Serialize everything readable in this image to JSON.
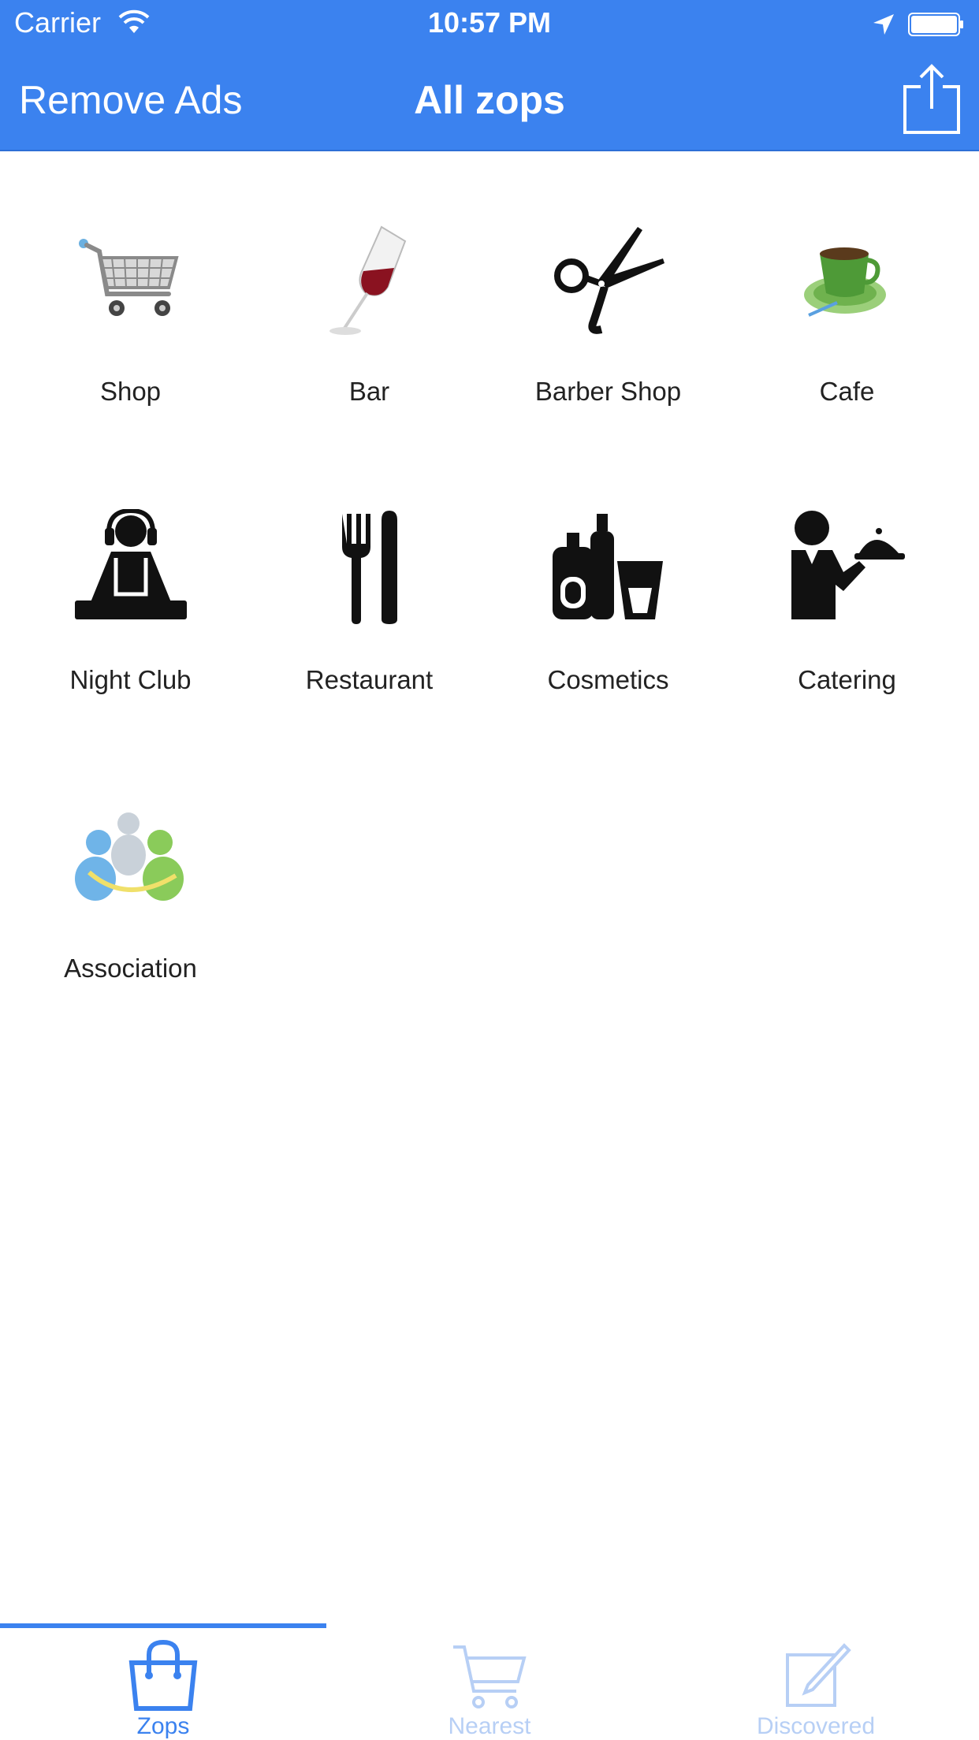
{
  "status_bar": {
    "carrier": "Carrier",
    "time": "10:57 PM"
  },
  "nav": {
    "left_button": "Remove Ads",
    "title": "All zops",
    "share_icon": "share-icon"
  },
  "categories": [
    {
      "label": "Shop",
      "icon": "shopping-cart-icon"
    },
    {
      "label": "Bar",
      "icon": "wine-glass-icon"
    },
    {
      "label": "Barber Shop",
      "icon": "scissors-icon"
    },
    {
      "label": "Cafe",
      "icon": "coffee-cup-icon"
    },
    {
      "label": "Night Club",
      "icon": "dj-icon"
    },
    {
      "label": "Restaurant",
      "icon": "fork-knife-icon"
    },
    {
      "label": "Cosmetics",
      "icon": "cosmetics-bottles-icon"
    },
    {
      "label": "Catering",
      "icon": "waiter-icon"
    },
    {
      "label": "Association",
      "icon": "people-group-icon"
    }
  ],
  "tabs": [
    {
      "label": "Zops",
      "icon": "shopping-bag-icon",
      "active": true
    },
    {
      "label": "Nearest",
      "icon": "shopping-cart-icon",
      "active": false
    },
    {
      "label": "Discovered",
      "icon": "edit-note-icon",
      "active": false
    }
  ],
  "colors": {
    "accent": "#3b82ef",
    "inactive_tab": "#b7cff5"
  }
}
